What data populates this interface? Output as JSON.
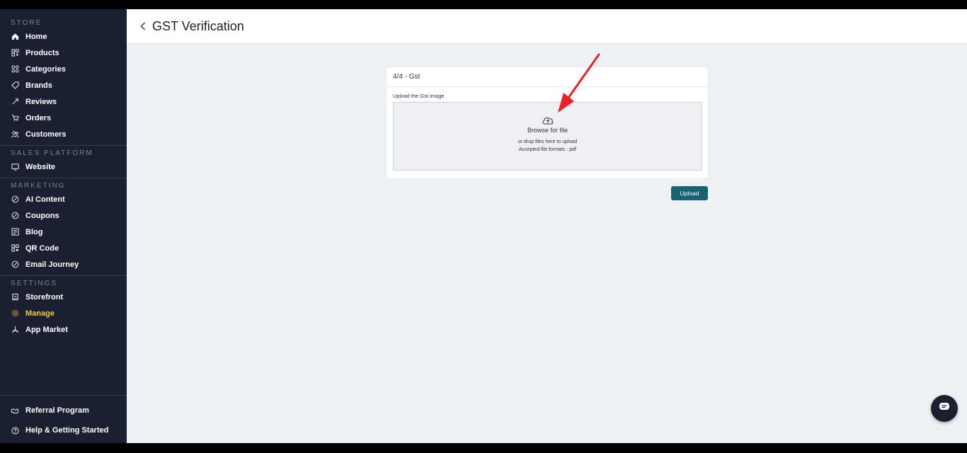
{
  "sidebar": {
    "sections": {
      "store": "STORE",
      "sales": "SALES PLATFORM",
      "marketing": "MARKETING",
      "settings": "SETTINGS"
    },
    "items": {
      "home": "Home",
      "products": "Products",
      "categories": "Categories",
      "brands": "Brands",
      "reviews": "Reviews",
      "orders": "Orders",
      "customers": "Customers",
      "website": "Website",
      "ai_content": "AI Content",
      "coupons": "Coupons",
      "blog": "Blog",
      "qr_code": "QR Code",
      "email_journey": "Email Journey",
      "storefront": "Storefront",
      "manage": "Manage",
      "app_market": "App Market"
    },
    "bottom": {
      "referral": "Referral Program",
      "help": "Help & Getting Started"
    },
    "active_item": "Manage",
    "active_color": "#f5c84b"
  },
  "header": {
    "title": "GST Verification"
  },
  "card": {
    "step": "4/4 - Gst",
    "upload_label": "Upload the Gst image",
    "browse": "Browse for file",
    "drop_hint": "or drop files here to upload",
    "formats": "Accepted file formats : pdf"
  },
  "actions": {
    "upload": "Upload"
  },
  "colors": {
    "sidebar_bg": "#1b2030",
    "button": "#1b6271",
    "annotation_arrow": "#e8202a"
  }
}
